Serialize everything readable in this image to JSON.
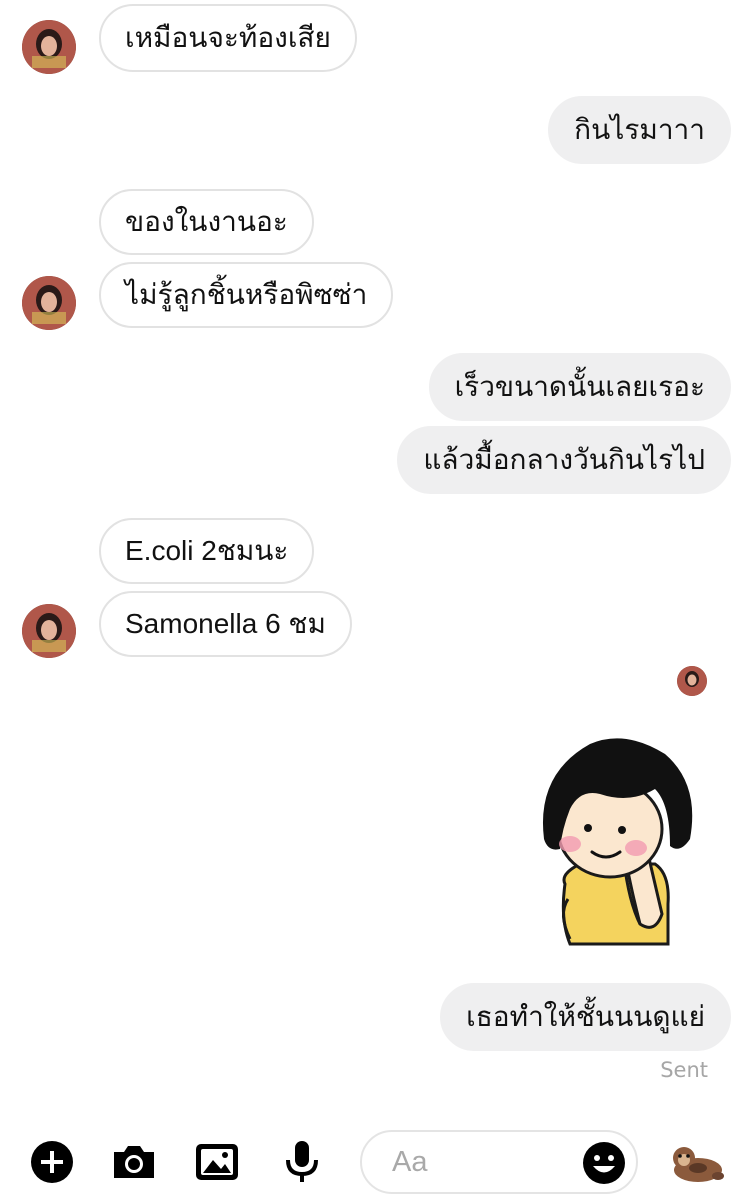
{
  "messages": {
    "m1": "เหมือนจะท้องเสีย",
    "m2": "กินไรมาาา",
    "m3": "ของในงานอะ",
    "m4": "ไม่รู้ลูกชิ้นหรือพิซซ่า",
    "m5": "เร็วขนาดนั้นเลยเรอะ",
    "m6": "แล้วมื้อกลางวันกินไรไป",
    "m7": "E.coli 2ชมนะ",
    "m8": "Samonella 6 ชม",
    "m9": "เธอทำให้ชั้นนนดูแย่"
  },
  "status": {
    "sent": "Sent"
  },
  "composer": {
    "placeholder": "Aa"
  },
  "icons": {
    "add": "plus-circle-icon",
    "camera": "camera-icon",
    "gallery": "image-icon",
    "voice": "microphone-icon",
    "emoji": "smiley-icon",
    "sticker": "otter-sticker-icon"
  },
  "colors": {
    "incoming_border": "#e2e2e2",
    "outgoing_bg": "#efeff0",
    "sent_text": "#a6a6a6"
  }
}
